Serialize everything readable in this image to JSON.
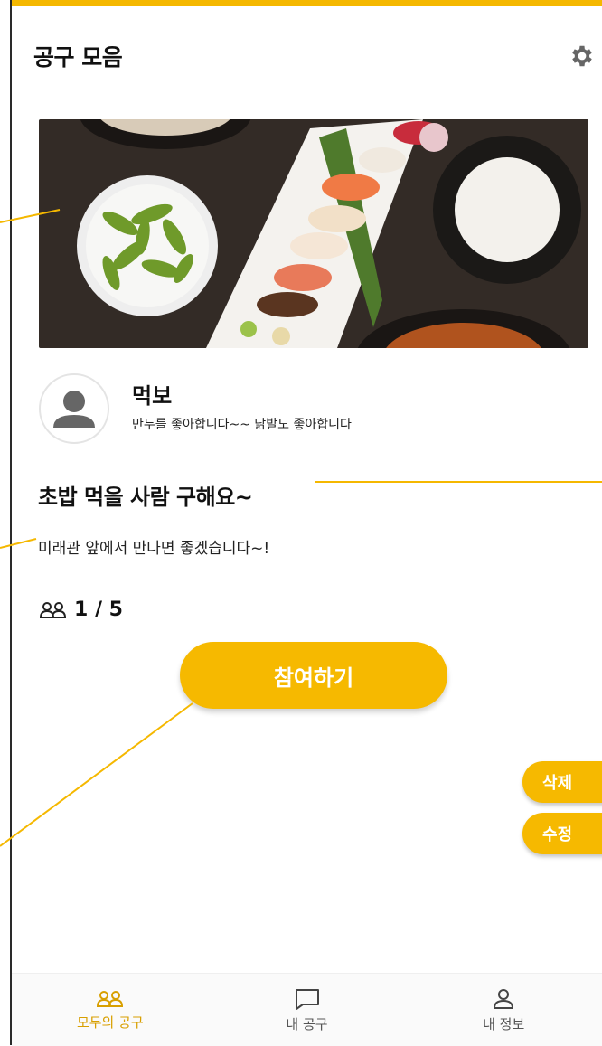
{
  "header": {
    "title": "공구 모음",
    "settings_icon": "gear-icon"
  },
  "post": {
    "author": {
      "name": "먹보",
      "bio": "만두를 좋아합니다~~ 닭발도 좋아합니다"
    },
    "title": "초밥 먹을 사람 구해요~",
    "body": "미래관 앞에서 만나면 좋겠습니다~!",
    "participants": "1 / 5",
    "join_label": "참여하기"
  },
  "admin": {
    "delete_label": "삭제",
    "edit_label": "수정"
  },
  "bottom_nav": {
    "items": [
      {
        "label": "모두의 공구",
        "icon": "group-icon",
        "active": true
      },
      {
        "label": "내 공구",
        "icon": "chat-icon",
        "active": false
      },
      {
        "label": "내 정보",
        "icon": "person-icon",
        "active": false
      }
    ]
  },
  "colors": {
    "accent": "#f6b900",
    "active_label": "#d89f00",
    "annotation": "#f5b800"
  }
}
